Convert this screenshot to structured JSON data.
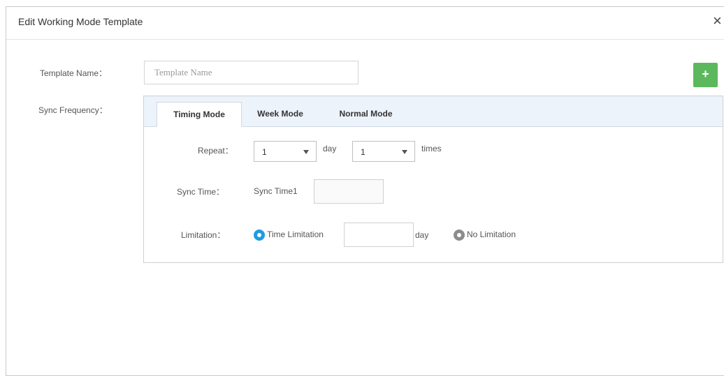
{
  "dialog": {
    "title": "Edit Working Mode Template",
    "close_icon": "×"
  },
  "form": {
    "template_name": {
      "label": "Template Name：",
      "placeholder": "Template Name",
      "value": ""
    },
    "add_button_icon": "+",
    "sync_frequency_label": "Sync Frequency："
  },
  "tabs": [
    {
      "label": "Timing Mode",
      "active": true
    },
    {
      "label": "Week Mode",
      "active": false
    },
    {
      "label": "Normal Mode",
      "active": false
    }
  ],
  "timing": {
    "repeat": {
      "label": "Repeat：",
      "day_value": "1",
      "day_unit": "day",
      "times_value": "1",
      "times_unit": "times"
    },
    "sync_time": {
      "label": "Sync Time：",
      "item_label": "Sync Time1",
      "value": ""
    },
    "limitation": {
      "label": "Limitation：",
      "option_time": "Time Limitation",
      "time_value": "",
      "time_unit": "day",
      "option_none": "No Limitation",
      "selected": "time"
    }
  },
  "colors": {
    "accent_blue": "#1e9be6",
    "add_green": "#5cb85c",
    "tabbar_bg": "#edf3fb"
  }
}
